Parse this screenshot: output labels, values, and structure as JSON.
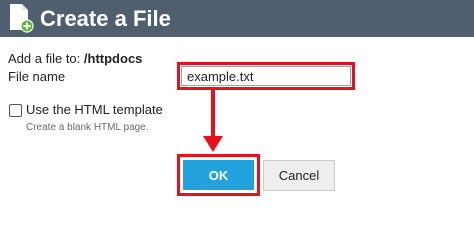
{
  "header": {
    "title": "Create a File",
    "icon": "new-file-icon",
    "background": "#4f5f6f"
  },
  "form": {
    "target_prefix": "Add a file to:",
    "target_path": "/httpdocs",
    "filename_label": "File name",
    "filename_value": "example.txt",
    "template_checkbox_label": "Use the HTML template",
    "template_checkbox_checked": false,
    "template_hint": "Create a blank HTML page."
  },
  "buttons": {
    "ok": "OK",
    "cancel": "Cancel"
  },
  "colors": {
    "highlight": "#e8101a",
    "ok_button": "#23a3dd"
  }
}
